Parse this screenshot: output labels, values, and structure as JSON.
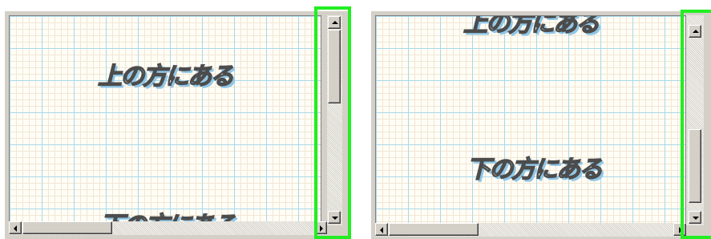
{
  "left_view": {
    "texts": [
      "上の方にある",
      "下の方にある"
    ]
  },
  "right_view": {
    "texts": [
      "上の方にある",
      "下の方にある"
    ]
  },
  "highlight_color": "#22ee22",
  "grid_major_color": "#a9d8ea",
  "grid_minor_color": "#f1e7d4"
}
